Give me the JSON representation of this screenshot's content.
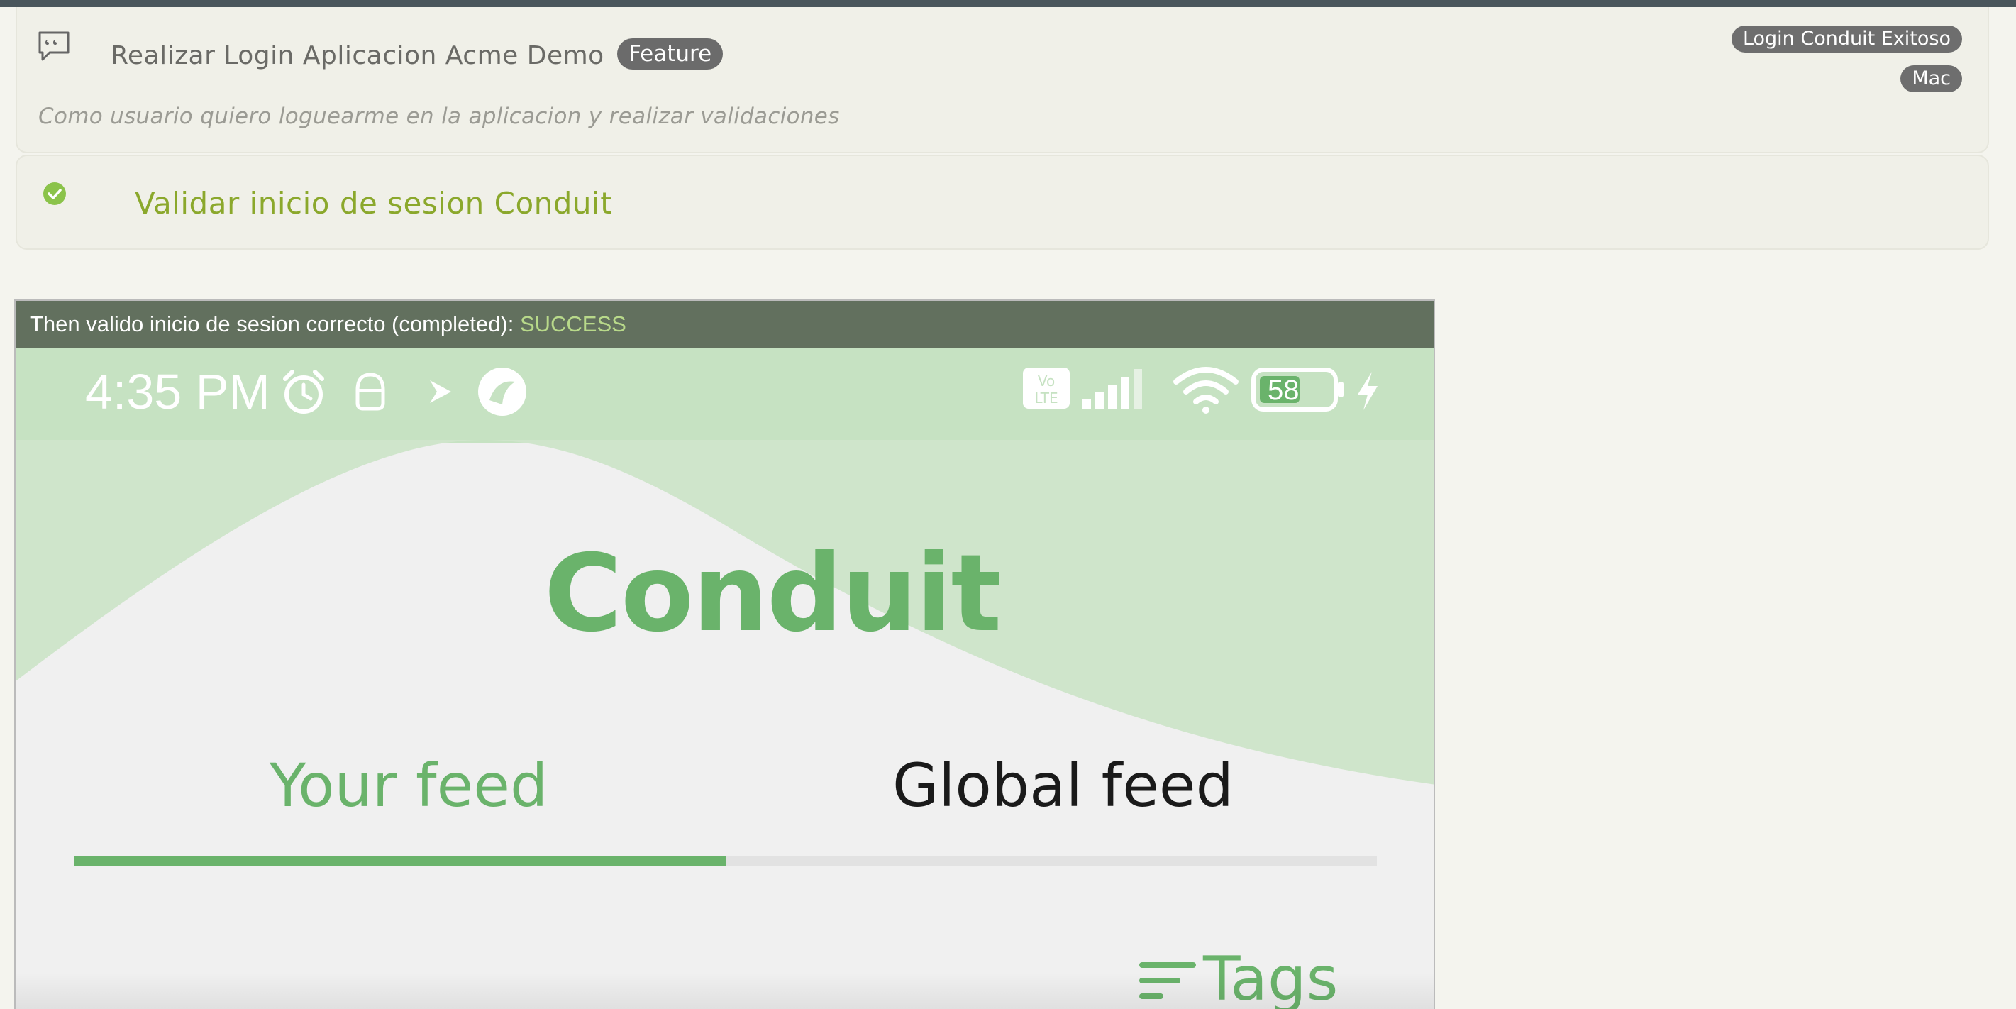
{
  "feature": {
    "icon": "comment-quote-icon",
    "title": "Realizar Login Aplicacion Acme Demo",
    "badge": "Feature",
    "description": "Como usuario quiero loguearme en la aplicacion y realizar validaciones",
    "tags": [
      "Login Conduit Exitoso",
      "Mac"
    ]
  },
  "scenario": {
    "icon": "check-circle-icon",
    "title": "Validar inicio de sesion Conduit",
    "status_color": "#8ba82c"
  },
  "step": {
    "text": "Then valido inicio de sesion correcto (completed): ",
    "status": "SUCCESS"
  },
  "screenshot": {
    "status_bar": {
      "time": "4:35 PM",
      "battery": "58",
      "icons": [
        "alarm-icon",
        "android-icon",
        "play-icon",
        "app-icon",
        "volte-icon",
        "signal-icon",
        "wifi-icon",
        "battery-icon",
        "charging-icon"
      ]
    },
    "app": {
      "brand": "Conduit",
      "tabs": [
        {
          "label": "Your feed",
          "active": true
        },
        {
          "label": "Global feed",
          "active": false
        }
      ],
      "active_tab_progress": 0.5,
      "tags_label": "Tags",
      "accent_color": "#6ab36b"
    }
  }
}
